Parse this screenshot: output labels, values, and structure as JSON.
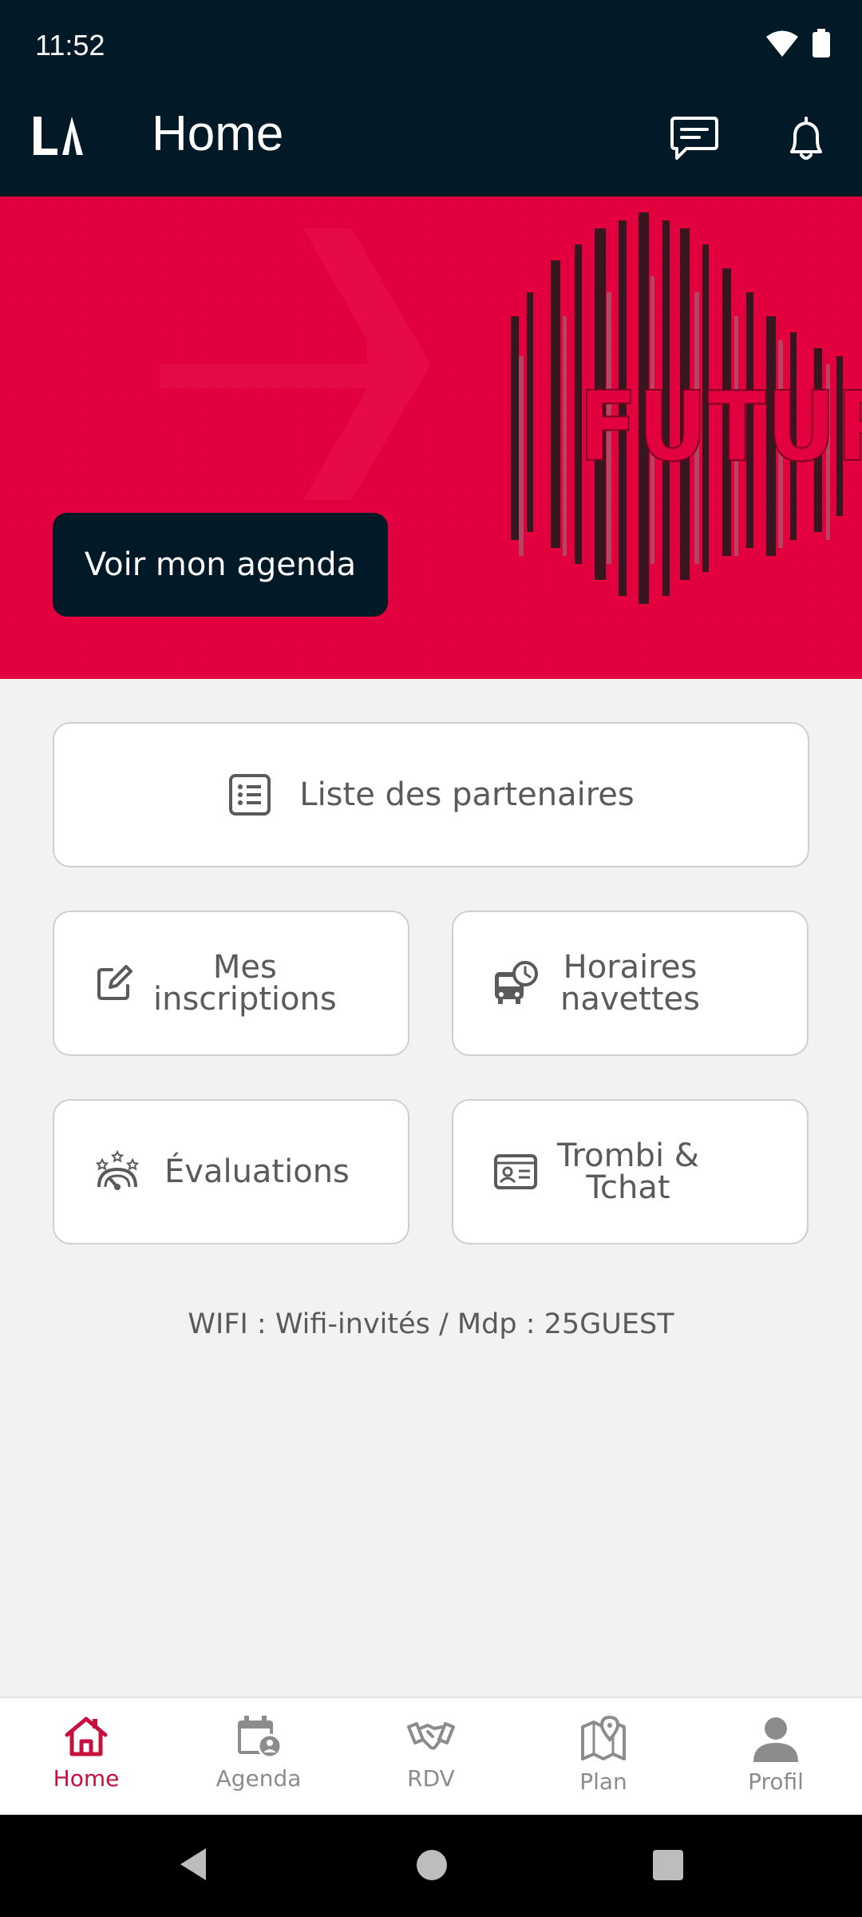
{
  "status": {
    "time": "11:52"
  },
  "appbar": {
    "logo": "LA",
    "title": "Home"
  },
  "banner": {
    "headline": "FUTURS",
    "cta_label": "Voir mon agenda",
    "accent_color": "#e2003f"
  },
  "tiles": {
    "partners": {
      "label": "Liste des partenaires",
      "icon": "list-icon"
    },
    "inscriptions": {
      "line1": "Mes",
      "line2": "inscriptions",
      "icon": "edit-icon"
    },
    "navettes": {
      "line1": "Horaires",
      "line2": "navettes",
      "icon": "bus-clock-icon"
    },
    "evaluations": {
      "label": "Évaluations",
      "icon": "rating-gauge-icon"
    },
    "trombi": {
      "line1": "Trombi &",
      "line2": "Tchat",
      "icon": "id-card-icon"
    }
  },
  "wifi_text": "WIFI : Wifi-invités / Mdp : 25GUEST",
  "bottom_nav": [
    {
      "label": "Home",
      "icon": "home-icon",
      "active": true
    },
    {
      "label": "Agenda",
      "icon": "calendar-user-icon",
      "active": false
    },
    {
      "label": "RDV",
      "icon": "handshake-icon",
      "active": false
    },
    {
      "label": "Plan",
      "icon": "map-pin-icon",
      "active": false
    },
    {
      "label": "Profil",
      "icon": "person-icon",
      "active": false
    }
  ],
  "colors": {
    "dark": "#021a28",
    "brand": "#e2003f",
    "active_nav": "#c8103e"
  }
}
